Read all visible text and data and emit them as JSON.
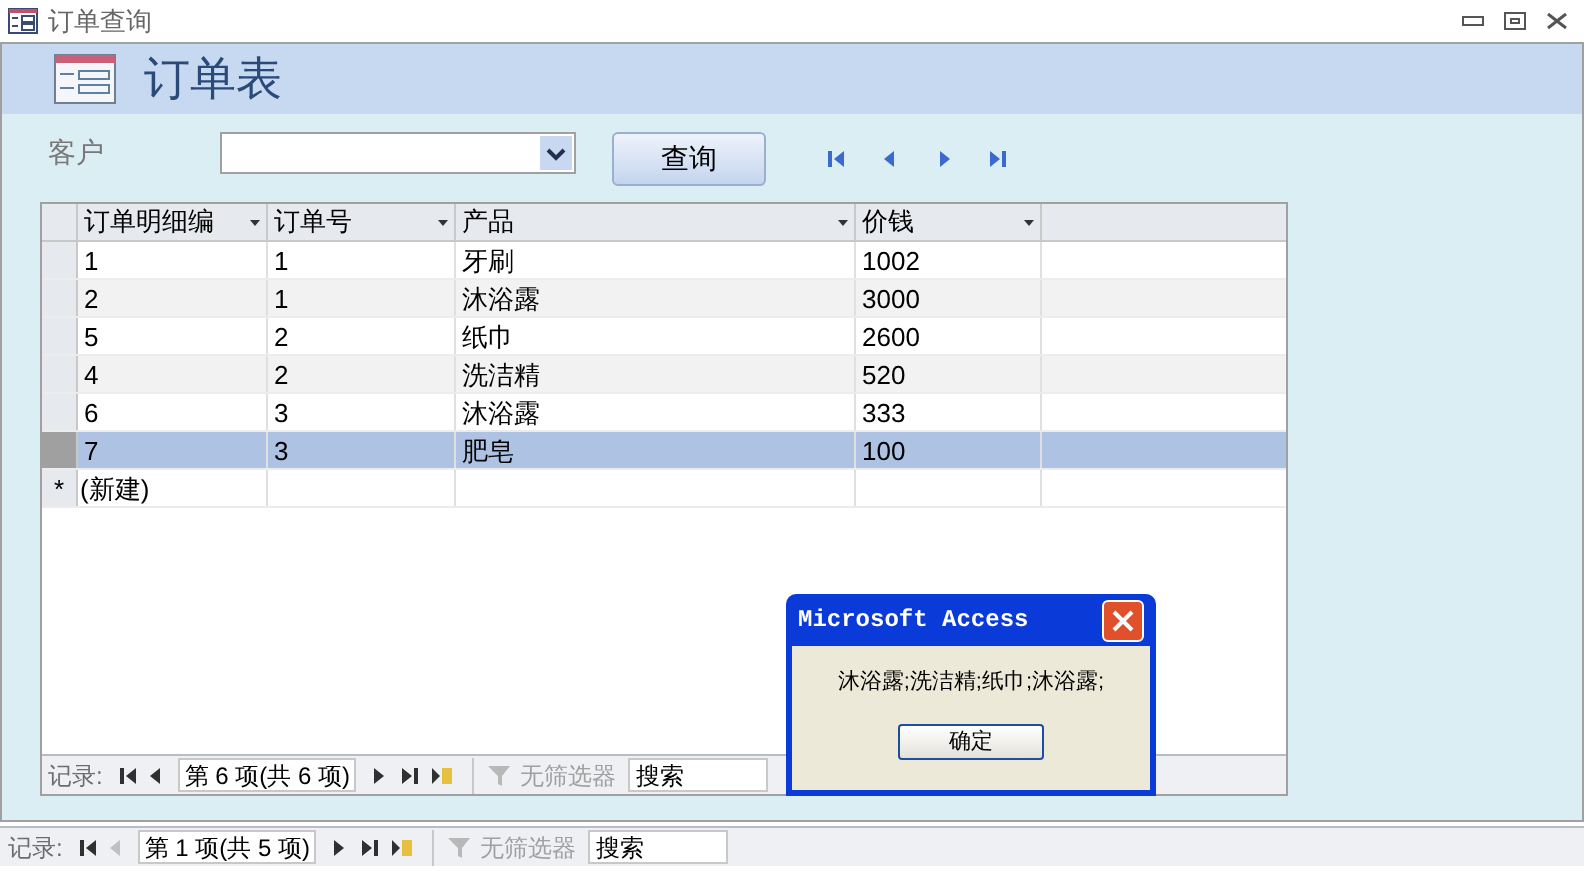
{
  "window": {
    "title": "订单查询"
  },
  "header": {
    "title": "订单表"
  },
  "filter": {
    "label": "客户",
    "query_button": "查询"
  },
  "form_nav": [
    {
      "kind": "first"
    },
    {
      "kind": "prev"
    },
    {
      "kind": "next"
    },
    {
      "kind": "last"
    }
  ],
  "table": {
    "columns": [
      {
        "label": "订单明细编"
      },
      {
        "label": "订单号"
      },
      {
        "label": "产品"
      },
      {
        "label": "价钱"
      }
    ],
    "rows": [
      {
        "cells": [
          "1",
          "1",
          "牙刷",
          "1002"
        ],
        "selected": false
      },
      {
        "cells": [
          "2",
          "1",
          "沐浴露",
          "3000"
        ],
        "selected": false
      },
      {
        "cells": [
          "5",
          "2",
          "纸巾",
          "2600"
        ],
        "selected": false
      },
      {
        "cells": [
          "4",
          "2",
          "洗洁精",
          "520"
        ],
        "selected": false
      },
      {
        "cells": [
          "6",
          "3",
          "沐浴露",
          "333"
        ],
        "selected": false
      },
      {
        "cells": [
          "7",
          "3",
          "肥皂",
          "100"
        ],
        "selected": true
      }
    ],
    "new_row": {
      "marker": "*",
      "label": "(新建)"
    },
    "record_nav": {
      "label": "记录:",
      "position": "第 6 项(共 6 项)",
      "filter": "无筛选器",
      "search_placeholder": "搜索",
      "buttons": [
        {
          "kind": "first",
          "disabled": false
        },
        {
          "kind": "prev",
          "disabled": false
        },
        {
          "kind": "next",
          "disabled": false
        },
        {
          "kind": "last",
          "disabled": false
        },
        {
          "kind": "new",
          "disabled": false
        }
      ]
    }
  },
  "dialog": {
    "title": "Microsoft Access",
    "message": "沐浴露;洗洁精;纸巾;沐浴露;",
    "ok_button": "确定"
  },
  "record_nav": {
    "label": "记录:",
    "position": "第 1 项(共 5 项)",
    "filter": "无筛选器",
    "search_placeholder": "搜索",
    "buttons": [
      {
        "kind": "first",
        "disabled": false
      },
      {
        "kind": "prev",
        "disabled": true
      },
      {
        "kind": "next",
        "disabled": false
      },
      {
        "kind": "last",
        "disabled": false
      },
      {
        "kind": "new",
        "disabled": false
      }
    ]
  }
}
